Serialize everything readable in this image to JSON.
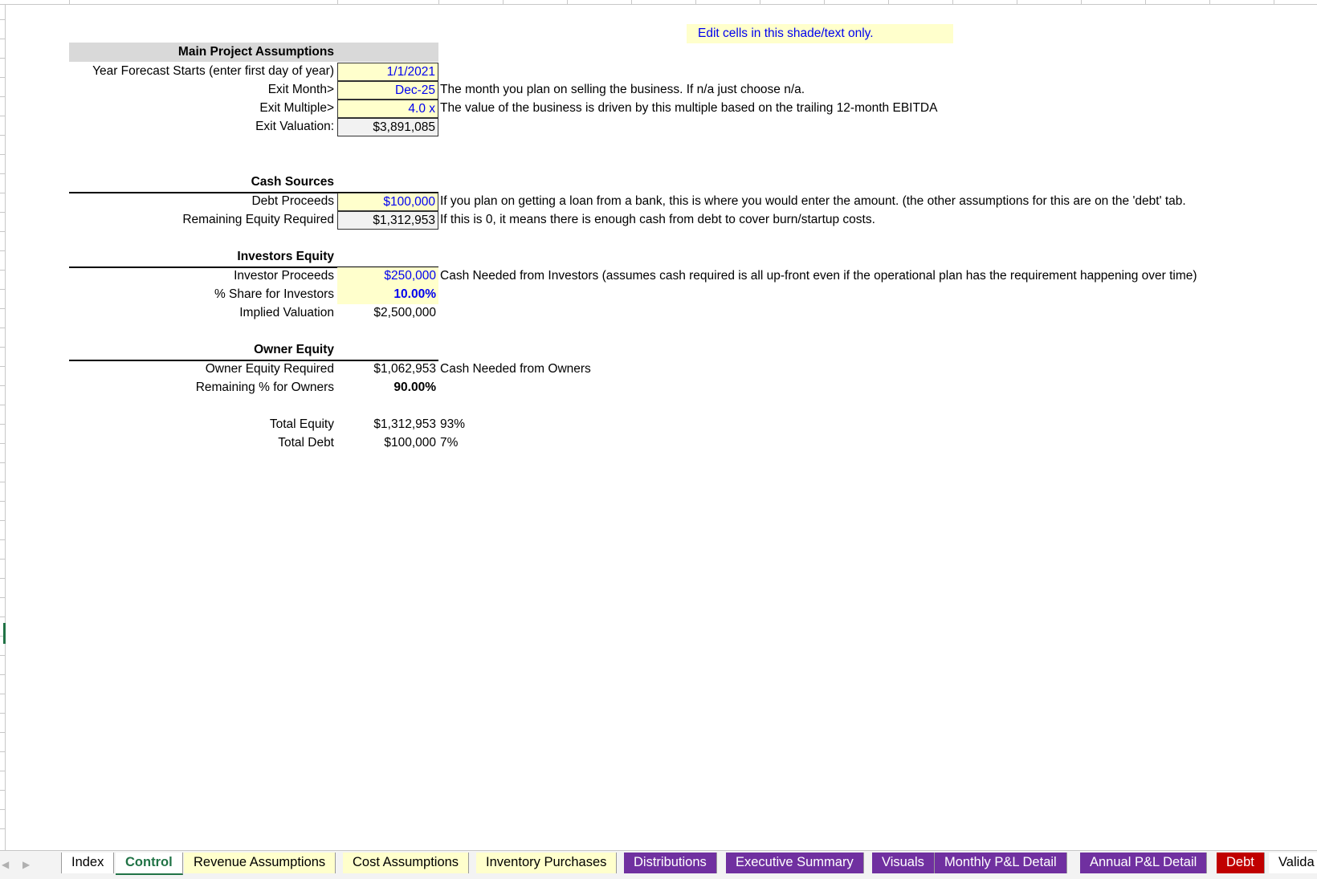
{
  "legend": "Edit cells in this shade/text only.",
  "main": {
    "title": "Main Project Assumptions",
    "rows": [
      {
        "label": "Year Forecast Starts (enter first day of year)",
        "value": "1/1/2021",
        "note": ""
      },
      {
        "label": "Exit Month>",
        "value": "Dec-25",
        "note": "The month you plan on selling the business. If n/a just choose n/a."
      },
      {
        "label": "Exit Multiple>",
        "value": "4.0 x",
        "note": "The value of the business is driven by this multiple based on the trailing 12-month EBITDA"
      },
      {
        "label": "Exit Valuation:",
        "value": "$3,891,085",
        "note": ""
      }
    ]
  },
  "cash_sources": {
    "title": "Cash Sources",
    "rows": [
      {
        "label": "Debt Proceeds",
        "value": "$100,000",
        "note": "If you plan on getting a loan from a bank, this is where you would enter the amount. (the other assumptions for this are on the 'debt' tab."
      },
      {
        "label": "Remaining Equity Required",
        "value": "$1,312,953",
        "note": "If this is 0, it means there is enough cash from debt to cover burn/startup costs."
      }
    ]
  },
  "investors": {
    "title": "Investors Equity",
    "rows": [
      {
        "label": "Investor Proceeds",
        "value": "$250,000",
        "note": "Cash Needed from Investors (assumes cash required is all up-front even if the operational plan has the requirement happening over time)"
      },
      {
        "label": "% Share for Investors",
        "value": "10.00%",
        "note": ""
      },
      {
        "label": "Implied Valuation",
        "value": "$2,500,000",
        "note": ""
      }
    ]
  },
  "owners": {
    "title": "Owner Equity",
    "rows": [
      {
        "label": "Owner Equity Required",
        "value": "$1,062,953",
        "note": "Cash Needed from Owners"
      },
      {
        "label": "Remaining % for Owners",
        "value": "90.00%",
        "note": ""
      }
    ]
  },
  "totals": {
    "rows": [
      {
        "label": "Total Equity",
        "value": "$1,312,953",
        "note": "93%"
      },
      {
        "label": "Total Debt",
        "value": "$100,000",
        "note": "7%"
      }
    ]
  },
  "tabs": [
    {
      "label": "Index"
    },
    {
      "label": "Control"
    },
    {
      "label": "Revenue Assumptions"
    },
    {
      "label": "Cost Assumptions"
    },
    {
      "label": "Inventory Purchases"
    },
    {
      "label": "Distributions"
    },
    {
      "label": "Executive Summary"
    },
    {
      "label": "Visuals"
    },
    {
      "label": "Monthly P&L Detail"
    },
    {
      "label": "Annual P&L Detail"
    },
    {
      "label": "Debt"
    },
    {
      "label": "Valida"
    }
  ],
  "nav": {
    "prev": "◀",
    "next": "▶"
  },
  "colors": {
    "input_fill": "#ffffcc",
    "input_text": "#0000ee",
    "purple_tab": "#7030a0",
    "red_tab": "#c00000",
    "active_tab_text": "#217346"
  }
}
